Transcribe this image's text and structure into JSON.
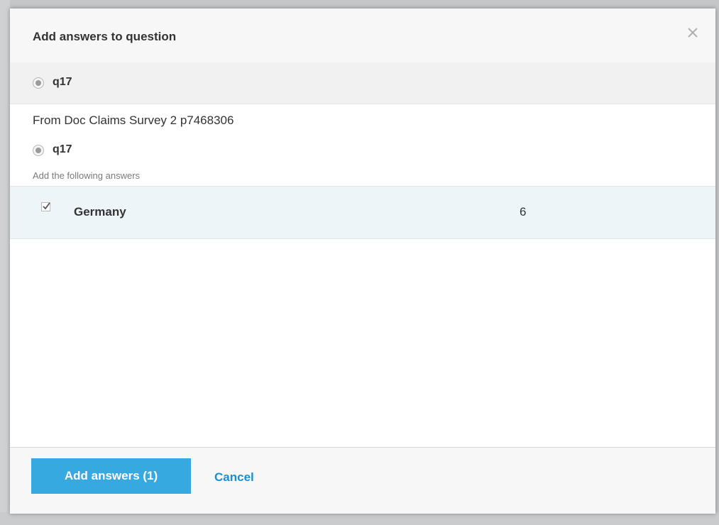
{
  "dialog": {
    "title": "Add answers to question",
    "target_question": "q17"
  },
  "source": {
    "title": "From Doc Claims Survey 2 p7468306",
    "question": "q17",
    "helper_text": "Add the following answers"
  },
  "answers": [
    {
      "label": "Germany",
      "count": "6",
      "checked": true
    }
  ],
  "footer": {
    "primary_label": "Add answers (1)",
    "cancel_label": "Cancel"
  },
  "colors": {
    "primary": "#36a9e1",
    "link": "#1a8fd0",
    "row_highlight": "#eef5f9"
  },
  "icons": {
    "close": "close-icon",
    "radio": "radio-selected-icon",
    "checkbox": "checkbox-checked-icon"
  }
}
